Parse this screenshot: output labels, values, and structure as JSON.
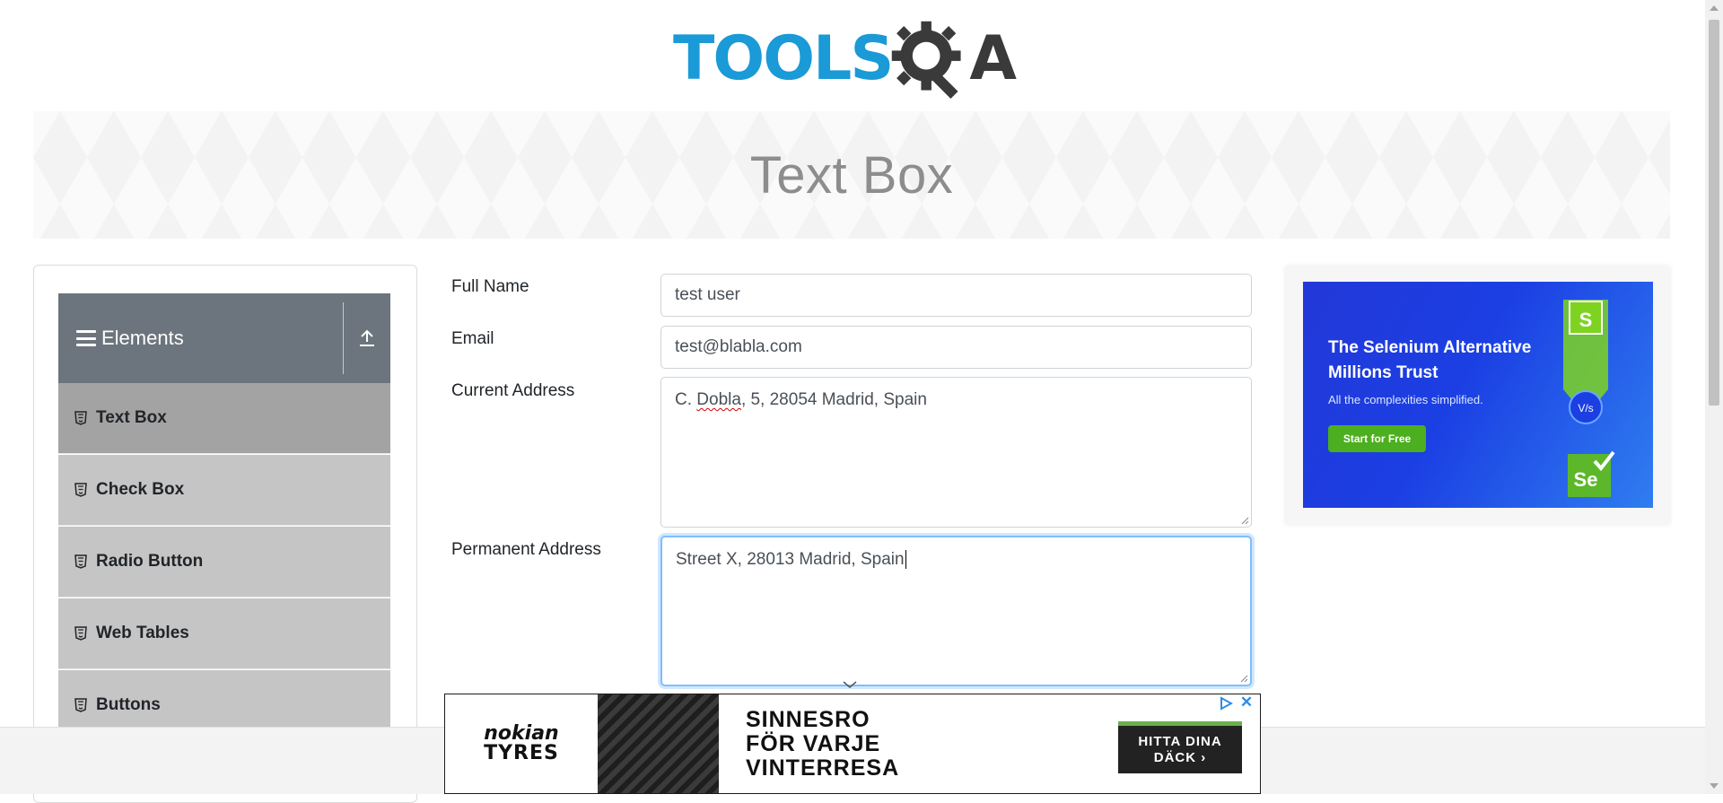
{
  "header": {
    "logo_tools": "TOOLS",
    "logo_a": "A"
  },
  "banner": {
    "title": "Text Box"
  },
  "sidebar": {
    "group_title": "Elements",
    "items": [
      {
        "label": "Text Box",
        "active": true
      },
      {
        "label": "Check Box",
        "active": false
      },
      {
        "label": "Radio Button",
        "active": false
      },
      {
        "label": "Web Tables",
        "active": false
      },
      {
        "label": "Buttons",
        "active": false
      }
    ]
  },
  "form": {
    "full_name": {
      "label": "Full Name",
      "value": "test user"
    },
    "email": {
      "label": "Email",
      "value": "test@blabla.com"
    },
    "current_address": {
      "label": "Current Address",
      "value_prefix": "C. ",
      "value_flagged": "Dobla",
      "value_suffix": ", 5, 28054 Madrid, Spain"
    },
    "permanent_address": {
      "label": "Permanent Address",
      "value": "Street X, 28013 Madrid, Spain"
    }
  },
  "ad_right": {
    "headline": "The Selenium Alternative Millions Trust",
    "subtext": "All the complexities simplified.",
    "cta": "Start for Free",
    "badge_s": "S",
    "badge_vs": "V/s",
    "badge_se": "Se"
  },
  "ad_bottom": {
    "brand_line1": "nokian",
    "brand_line2": "TYRES",
    "headline_line1": "SINNESRO",
    "headline_line2": "FÖR VARJE",
    "headline_line3": "VINTERRESA",
    "cta": "HITTA DINA DÄCK ›",
    "close": "✕"
  },
  "colors": {
    "logo_blue": "#1a9ad6",
    "sidebar_header": "#6c757d",
    "menu_item": "#c5c5c5",
    "menu_item_active": "#a3a3a3",
    "focus_ring": "#80bdff",
    "ad_cta_green": "#4caf1f"
  }
}
